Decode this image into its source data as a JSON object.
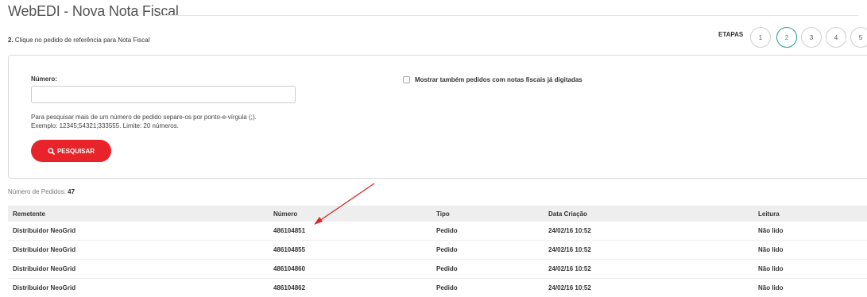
{
  "header": {
    "title": "WebEDI - Nova Nota Fiscal",
    "step_number": "2.",
    "step_text": " Clique no pedido de referência para Nota Fiscal"
  },
  "etapas": {
    "label": "ETAPAS",
    "steps": [
      "1",
      "2",
      "3",
      "4",
      "5"
    ],
    "active_step": "2"
  },
  "search": {
    "numero_label": "Número:",
    "numero_value": "",
    "numero_placeholder": "",
    "help_line1": "Para pesquisar mais de um número de pedido separe-os por ponto-e-vírgula (;).",
    "help_line2": "Exemplo: 12345;54321;333555. Limite: 20 números.",
    "button_label": "PESQUISAR",
    "checkbox_label": "Mostrar também pedidos com notas fiscais já digitadas",
    "checkbox_checked": false
  },
  "count": {
    "label": "Número de Pedidos: ",
    "value": "47"
  },
  "table": {
    "columns": [
      "Remetente",
      "Número",
      "Tipo",
      "Data Criação",
      "Leitura"
    ],
    "rows": [
      [
        "Distribuidor NeoGrid",
        "486104851",
        "Pedido",
        "24/02/16 10:52",
        "Não lido"
      ],
      [
        "Distribuidor NeoGrid",
        "486104855",
        "Pedido",
        "24/02/16 10:52",
        "Não lido"
      ],
      [
        "Distribuidor NeoGrid",
        "486104860",
        "Pedido",
        "24/02/16 10:52",
        "Não lido"
      ],
      [
        "Distribuidor NeoGrid",
        "486104862",
        "Pedido",
        "24/02/16 10:52",
        "Não lido"
      ]
    ]
  },
  "colors": {
    "accent_red": "#e8232a",
    "active_step": "#2a9d8f",
    "annotation_arrow": "#d9262c"
  }
}
